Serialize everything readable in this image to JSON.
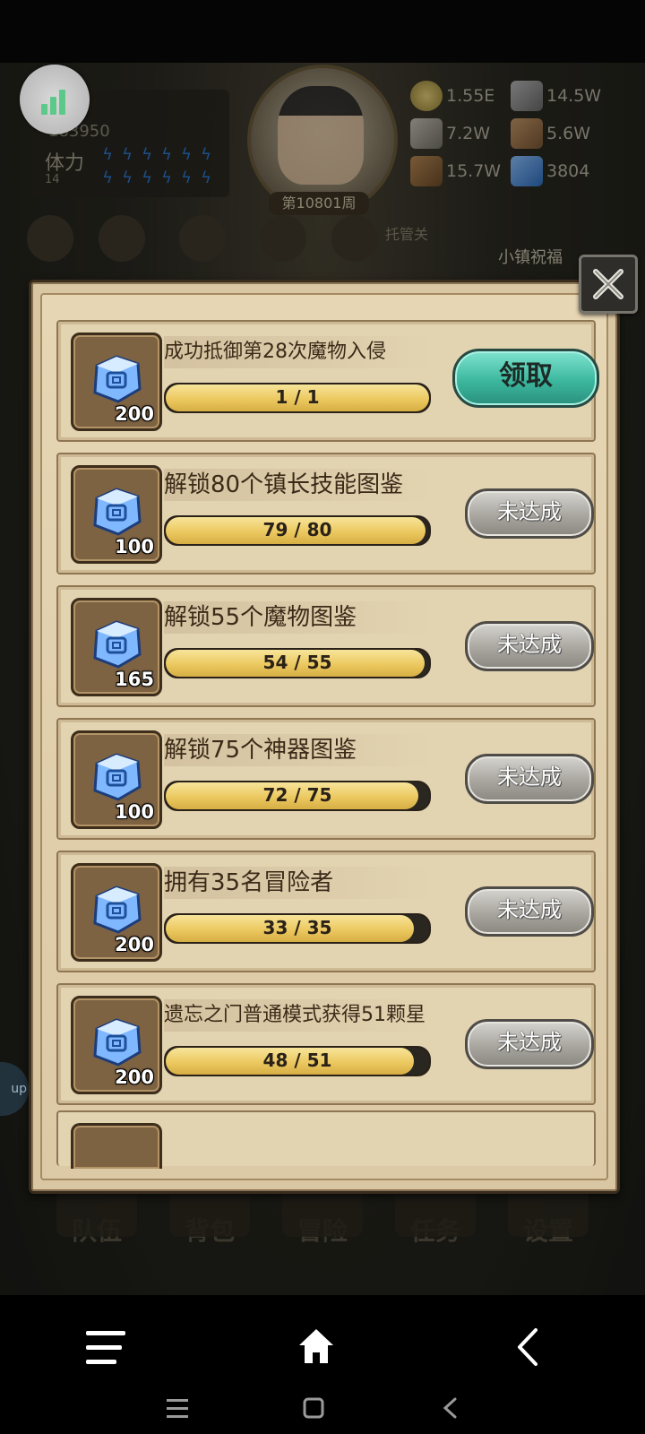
{
  "hud": {
    "player_id": "183950",
    "stamina_label": "体力",
    "stamina_value": "14",
    "week_label": "第10801周",
    "auto_label": "托管关",
    "town_label": "小镇祝福",
    "resources": [
      {
        "icon": "gold-coin-icon",
        "value": "1.55E"
      },
      {
        "icon": "iron-ore-icon",
        "value": "14.5W"
      },
      {
        "icon": "stone-icon",
        "value": "7.2W"
      },
      {
        "icon": "leather-icon",
        "value": "5.6W"
      },
      {
        "icon": "wood-icon",
        "value": "15.7W"
      },
      {
        "icon": "crystal-icon",
        "value": "3804"
      }
    ]
  },
  "side_tab_label": "up",
  "tasks": [
    {
      "title": "成功抵御第28次魔物入侵",
      "reward": "200",
      "progress_text": "1 / 1",
      "progress": 1.0,
      "button": "领取",
      "claimable": true
    },
    {
      "title": "解锁80个镇长技能图鉴",
      "reward": "100",
      "progress_text": "79 / 80",
      "progress": 0.9875,
      "button": "未达成",
      "claimable": false
    },
    {
      "title": "解锁55个魔物图鉴",
      "reward": "165",
      "progress_text": "54 / 55",
      "progress": 0.9818,
      "button": "未达成",
      "claimable": false
    },
    {
      "title": "解锁75个神器图鉴",
      "reward": "100",
      "progress_text": "72 / 75",
      "progress": 0.96,
      "button": "未达成",
      "claimable": false
    },
    {
      "title": "拥有35名冒险者",
      "reward": "200",
      "progress_text": "33 / 35",
      "progress": 0.9429,
      "button": "未达成",
      "claimable": false
    },
    {
      "title": "遗忘之门普通模式获得51颗星",
      "reward": "200",
      "progress_text": "48 / 51",
      "progress": 0.9412,
      "button": "未达成",
      "claimable": false
    }
  ],
  "bottom_tabs": [
    "队伍",
    "背包",
    "冒险",
    "任务",
    "设置"
  ]
}
